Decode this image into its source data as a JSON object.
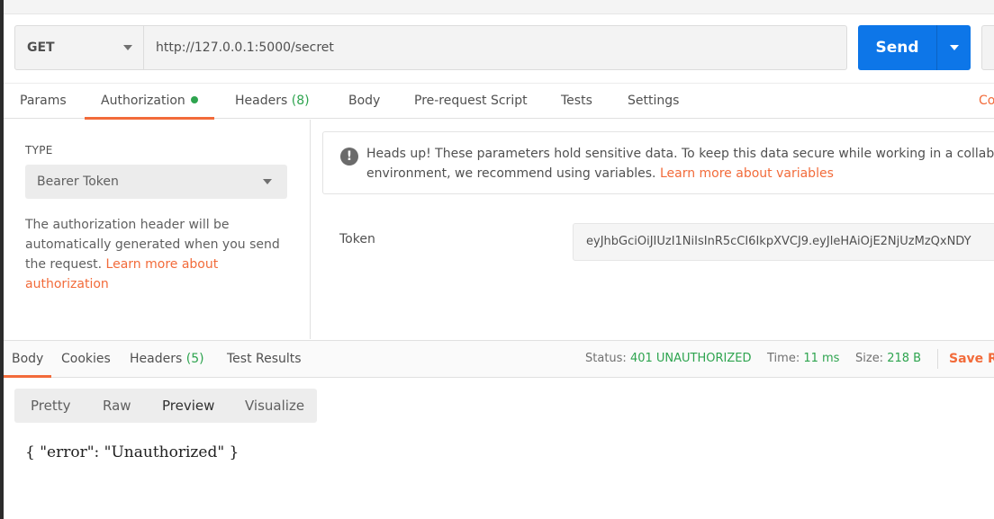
{
  "request": {
    "method": "GET",
    "url": "http://127.0.0.1:5000/secret",
    "send_label": "Send"
  },
  "request_tabs": {
    "params": "Params",
    "authorization": "Authorization",
    "headers": "Headers",
    "headers_count": "(8)",
    "body": "Body",
    "prerequest": "Pre-request Script",
    "tests": "Tests",
    "settings": "Settings",
    "cookies": "Co"
  },
  "auth": {
    "type_label": "TYPE",
    "type_value": "Bearer Token",
    "description": "The authorization header will be automatically generated when you send the request.",
    "learn_more": "Learn more about authorization",
    "notice_line1": "Heads up! These parameters hold sensitive data. To keep this data secure while working in a collabo",
    "notice_line2": "environment, we recommend using variables.",
    "notice_link": "Learn more about variables",
    "token_label": "Token",
    "token_value": "eyJhbGciOiJIUzI1NiIsInR5cCI6IkpXVCJ9.eyJleHAiOjE2NjUzMzQxNDY"
  },
  "response_tabs": {
    "body": "Body",
    "cookies": "Cookies",
    "headers": "Headers",
    "headers_count": "(5)",
    "test_results": "Test Results"
  },
  "response_meta": {
    "status_label": "Status:",
    "status_value": "401 UNAUTHORIZED",
    "time_label": "Time:",
    "time_value": "11 ms",
    "size_label": "Size:",
    "size_value": "218 B",
    "save_label": "Save Re"
  },
  "format_buttons": {
    "pretty": "Pretty",
    "raw": "Raw",
    "preview": "Preview",
    "visualize": "Visualize"
  },
  "response_body": "{ \"error\": \"Unauthorized\" }",
  "colors": {
    "accent": "#f26b3a",
    "send": "#0d76e8",
    "success": "#2ea44f"
  }
}
